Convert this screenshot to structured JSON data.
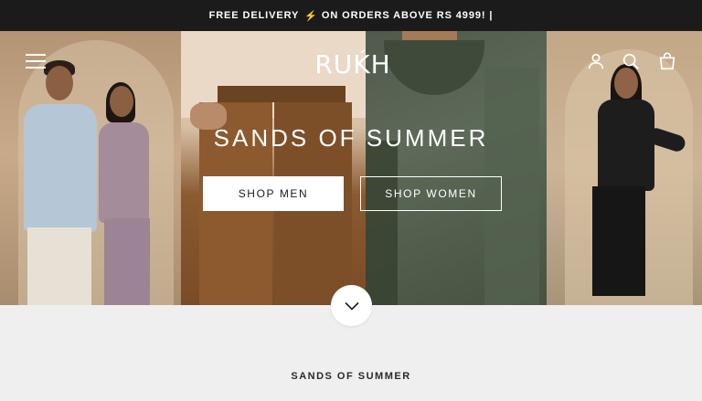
{
  "announcement": {
    "text_before": "FREE DELIVERY",
    "icon": "lightning-bolt-icon",
    "text_after": "ON ORDERS ABOVE RS 4999!",
    "divider": "|"
  },
  "header": {
    "logo_text": "RUḰH",
    "menu_icon": "hamburger-menu-icon",
    "account_icon": "account-icon",
    "search_icon": "search-icon",
    "cart_icon": "shopping-bag-icon"
  },
  "hero": {
    "headline": "SANDS OF SUMMER",
    "cta_men": "SHOP MEN",
    "cta_women": "SHOP WOMEN",
    "scroll_icon": "chevron-down-icon"
  },
  "section": {
    "title": "SANDS OF SUMMER"
  },
  "colors": {
    "announcement_bg": "#1b1b1b",
    "bolt": "#f5b21f",
    "page_bg": "#efefef"
  }
}
